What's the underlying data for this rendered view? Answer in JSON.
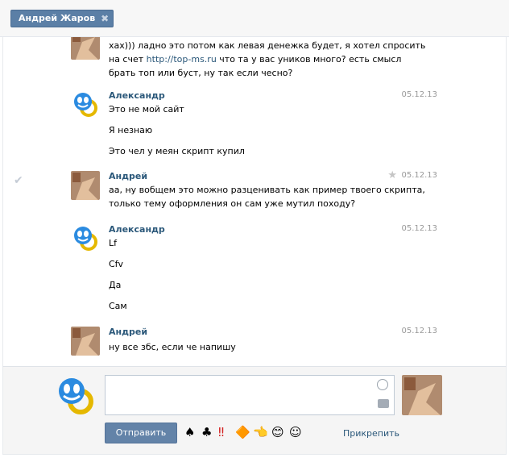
{
  "tab": {
    "title": "Андрей Жаров",
    "close": "✖"
  },
  "messages": [
    {
      "text": [
        "хах))) ладно это потом как левая денежка будет, я хотел спросить",
        "на счет ",
        "что та у вас уников много? есть смысл",
        "брать топ или буст, ну так если чесно?"
      ],
      "link": "http://top-ms.ru"
    },
    {
      "author": "Александр",
      "date": "05.12.13",
      "lines": [
        "Это не мой сайт",
        "Я незнаю",
        "Это чел у меян скрипт купил"
      ]
    },
    {
      "author": "Андрей",
      "date": "05.12.13",
      "lines": [
        "аа, ну вобщем это можно разценивать как пример твоего скрипта,",
        "только тему оформления он сам уже мутил походу?"
      ]
    },
    {
      "author": "Александр",
      "date": "05.12.13",
      "lines": [
        "Lf",
        "Cfv",
        "Да",
        "Сам"
      ]
    },
    {
      "author": "Андрей",
      "date": "05.12.13",
      "lines": [
        "ну все збс, если че напишу"
      ]
    }
  ],
  "composer": {
    "send_label": "Отправить",
    "attach_label": "Прикрепить",
    "emojis": [
      "♠",
      "♣",
      "‼",
      "🔶",
      "👈",
      "😊",
      "☺"
    ]
  },
  "colors": {
    "link": "#2b587a",
    "button": "#6383a8",
    "chip": "#5b7fa6"
  }
}
